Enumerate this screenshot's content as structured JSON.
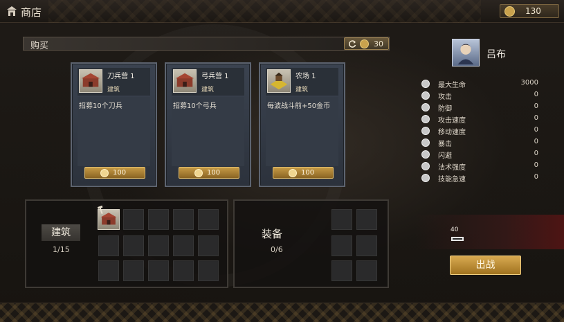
{
  "header": {
    "title": "商店",
    "gold": "130"
  },
  "buy": {
    "label": "购买",
    "refresh_cost": "30"
  },
  "cards": [
    {
      "name": "刀兵营 1",
      "type": "建筑",
      "desc": "招募10个刀兵",
      "price": "100",
      "icon": "sword-barracks-icon"
    },
    {
      "name": "弓兵营 1",
      "type": "建筑",
      "desc": "招募10个弓兵",
      "price": "100",
      "icon": "archer-barracks-icon"
    },
    {
      "name": "农场 1",
      "type": "建筑",
      "desc": "每波战斗前+50金币",
      "price": "100",
      "icon": "farm-icon"
    }
  ],
  "inventory": {
    "buildings_label": "建筑",
    "buildings_count": "1/15",
    "equipment_label": "装备",
    "equipment_count": "0/6"
  },
  "hero": {
    "name": "吕布",
    "stats": [
      {
        "label": "最大生命",
        "value": "3000",
        "icon": "heart-icon"
      },
      {
        "label": "攻击",
        "value": "0",
        "icon": "sword-icon"
      },
      {
        "label": "防御",
        "value": "0",
        "icon": "shield-icon"
      },
      {
        "label": "攻击速度",
        "value": "0",
        "icon": "attack-speed-icon"
      },
      {
        "label": "移动速度",
        "value": "0",
        "icon": "move-speed-icon"
      },
      {
        "label": "暴击",
        "value": "0",
        "icon": "critical-icon"
      },
      {
        "label": "闪避",
        "value": "0",
        "icon": "dodge-icon"
      },
      {
        "label": "法术强度",
        "value": "0",
        "icon": "magic-icon"
      },
      {
        "label": "技能急速",
        "value": "0",
        "icon": "haste-icon"
      }
    ]
  },
  "troop": {
    "level": "40"
  },
  "battle_button": "出战",
  "colors": {
    "gold_accent": "#c59a45",
    "card_bg": "#3b4350",
    "panel_border": "#3e3a35"
  }
}
